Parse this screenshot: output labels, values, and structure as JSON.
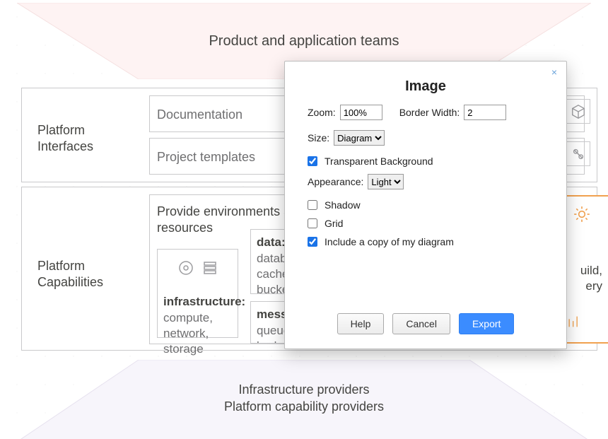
{
  "top_banner": "Product and application teams",
  "bottom_banner_line1": "Infrastructure providers",
  "bottom_banner_line2": "Platform capability providers",
  "interfaces": {
    "label_line1": "Platform",
    "label_line2": "Interfaces",
    "documentation": "Documentation",
    "project_templates": "Project templates"
  },
  "capabilities": {
    "label_line1": "Platform",
    "label_line2": "Capabilities",
    "env_title_line1": "Provide environments and",
    "env_title_line2": "resources",
    "infra_header": "infrastructure:",
    "infra_body": "compute,\nnetwork,\nstorage",
    "data_header": "data:",
    "data_body": "database,\ncache,\nbucket",
    "msg_header": "messaging",
    "msg_body": "queue,\nbroker",
    "build_text": "uild,\nery"
  },
  "modal": {
    "title": "Image",
    "zoom_label": "Zoom:",
    "zoom_value": "100%",
    "border_label": "Border Width:",
    "border_value": "2",
    "size_label": "Size:",
    "size_option": "Diagram",
    "transparent_label": "Transparent Background",
    "transparent_checked": true,
    "appearance_label": "Appearance:",
    "appearance_option": "Light",
    "shadow_label": "Shadow",
    "shadow_checked": false,
    "grid_label": "Grid",
    "grid_checked": false,
    "include_copy_label": "Include a copy of my diagram",
    "include_copy_checked": true,
    "help_btn": "Help",
    "cancel_btn": "Cancel",
    "export_btn": "Export",
    "close_glyph": "×"
  },
  "icons": {
    "cube": "cube-icon",
    "tools": "tools-icon",
    "gear": "gear-icon",
    "stats": "stats-icon",
    "disc": "disc-icon",
    "stack": "stack-icon"
  }
}
